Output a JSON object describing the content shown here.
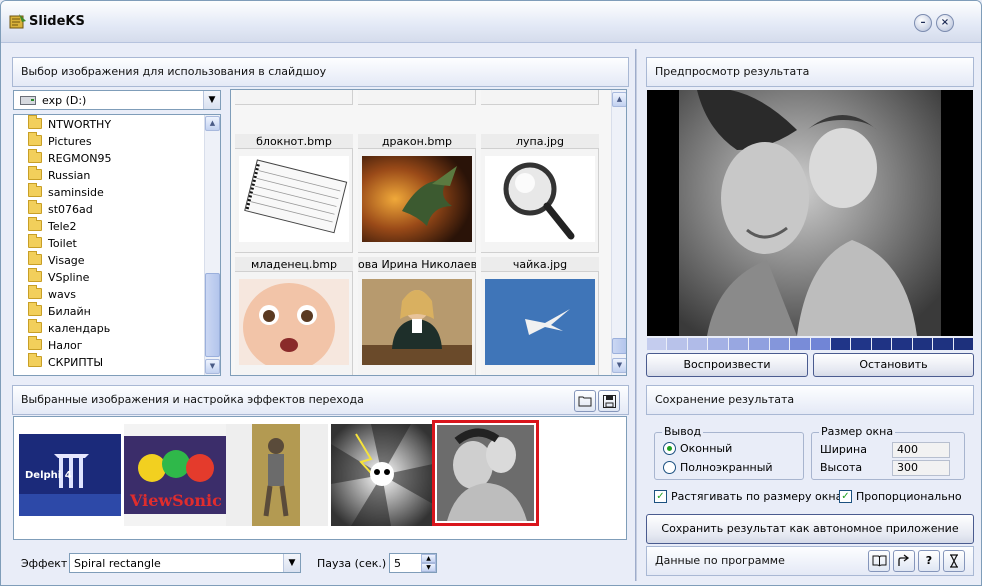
{
  "app": {
    "title": "SlideKS"
  },
  "titlebar": {
    "minimize": "–",
    "close": "×"
  },
  "source": {
    "header": "Выбор изображения для использования в слайдшоу",
    "drive": "exp (D:)",
    "folders": [
      "NTWORTHY",
      "Pictures",
      "REGMON95",
      "Russian",
      "saminside",
      "st076ad",
      "Tele2",
      "Toilet",
      "Visage",
      "VSpline",
      "wavs",
      "Билайн",
      "календарь",
      "Налог",
      "СКРИПТЫ"
    ],
    "files": [
      {
        "name": "блокнот.bmp"
      },
      {
        "name": "дракон.bmp"
      },
      {
        "name": "лупа.jpg"
      },
      {
        "name": "младенец.bmp"
      },
      {
        "name": "ова Ирина Николаевна"
      },
      {
        "name": "чайка.jpg"
      }
    ]
  },
  "selected": {
    "header": "Выбранные изображения и настройка эффектов перехода",
    "open_icon": "folder-icon",
    "save_icon": "disk-icon",
    "effect_label": "Эффект",
    "effect_value": "Spiral rectangle",
    "pause_label": "Пауза (сек.)",
    "pause_value": "5"
  },
  "preview": {
    "header": "Предпросмотр результата",
    "play": "Воспроизвести",
    "stop": "Остановить",
    "progress_segments": 16,
    "progress_filled": 0.56
  },
  "save": {
    "header": "Сохранение результата",
    "output_group": "Вывод",
    "windowed": "Оконный",
    "fullscreen": "Полноэкранный",
    "size_group": "Размер окна",
    "width_label": "Ширина",
    "width_value": "400",
    "height_label": "Высота",
    "height_value": "300",
    "stretch": "Растягивать по размеру окна",
    "proportional": "Пропорционально",
    "export_button": "Сохранить результат как автономное приложение"
  },
  "about": {
    "label": "Данные по программе",
    "book_icon": "book-icon",
    "share_icon": "share-icon",
    "help": "?",
    "hourglass_icon": "hourglass-icon"
  },
  "colors": {
    "accent": "#2f54a8",
    "selection": "#d9151c",
    "check": "#21a121"
  }
}
